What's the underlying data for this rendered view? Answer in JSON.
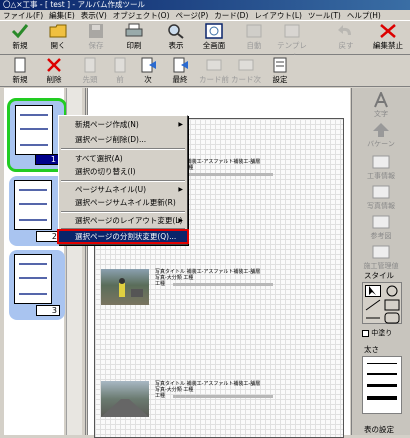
{
  "window": {
    "title": "〇△×工事 - [ test ] - アルバム作成ツール"
  },
  "menubar": [
    "ファイル(F)",
    "編集(E)",
    "表示(V)",
    "オブジェクト(O)",
    "ページ(P)",
    "カード(D)",
    "レイアウト(L)",
    "ツール(T)",
    "ヘルプ(H)"
  ],
  "toolbar1": [
    {
      "label": "新規",
      "icon": "check-icon",
      "enabled": true
    },
    {
      "label": "開く",
      "icon": "folder-icon",
      "enabled": true
    },
    {
      "label": "保存",
      "icon": "save-icon",
      "enabled": false
    },
    {
      "label": "印刷",
      "icon": "printer-icon",
      "enabled": true
    },
    {
      "label": "表示",
      "icon": "magnifier-icon",
      "enabled": true
    },
    {
      "label": "全画面",
      "icon": "fullscreen-icon",
      "enabled": true
    },
    {
      "label": "自動",
      "icon": "auto-icon",
      "enabled": false
    },
    {
      "label": "テンプレート",
      "icon": "template-icon",
      "enabled": false
    },
    {
      "label": "戻す",
      "icon": "undo-icon",
      "enabled": false
    },
    {
      "label": "編集禁止",
      "icon": "edit-lock-icon",
      "enabled": true
    }
  ],
  "toolbar2": [
    {
      "label": "新規",
      "icon": "new-page-icon",
      "enabled": true
    },
    {
      "label": "削除",
      "icon": "delete-icon",
      "enabled": true
    },
    {
      "label": "先頭",
      "icon": "first-page-icon",
      "enabled": false
    },
    {
      "label": "前",
      "icon": "prev-page-icon",
      "enabled": false
    },
    {
      "label": "次",
      "icon": "next-page-icon",
      "enabled": true
    },
    {
      "label": "最終",
      "icon": "last-page-icon",
      "enabled": true
    },
    {
      "label": "カード前",
      "icon": "card-prev-icon",
      "enabled": false
    },
    {
      "label": "カード次",
      "icon": "card-next-icon",
      "enabled": false
    },
    {
      "label": "設定",
      "icon": "settings-icon",
      "enabled": true
    }
  ],
  "thumbnails": [
    {
      "num": "1"
    },
    {
      "num": "2"
    },
    {
      "num": "3"
    }
  ],
  "context_menu": [
    {
      "label": "新規ページ作成(N)",
      "submenu": true
    },
    {
      "label": "選択ページ削除(D)...",
      "submenu": false
    },
    {
      "label": "すべて選択(A)",
      "submenu": false
    },
    {
      "label": "選択の切り替え(I)",
      "submenu": false
    },
    {
      "label": "ページサムネイル(U)",
      "submenu": true
    },
    {
      "label": "選択ページサムネイル更新(R)",
      "submenu": false
    },
    {
      "label": "選択ページのレイアウト変更(L)",
      "submenu": true
    },
    {
      "label": "選択ページの分割状変更(Q)...",
      "submenu": false,
      "selected": true
    }
  ],
  "blocks": [
    {
      "line1": "写真タイトル 補装工-アスファルト補装工-舗層",
      "line2": "写真-大分類 工種",
      "line3": "工種"
    },
    {
      "line1": "写真タイトル 補装工-アスファルト補装工-舗層",
      "line2": "写真-大分類 工種",
      "line3": "工種"
    },
    {
      "line1": "写真タイトル 補装工-アスファルト補装工-舗層",
      "line2": "写真-大分類 工種",
      "line3": "工種"
    }
  ],
  "sidebar": {
    "buttons": [
      {
        "label": "文字",
        "icon": "text-a-icon"
      },
      {
        "label": "バケーン",
        "icon": "arrow-up-icon"
      },
      {
        "label": "工事情報",
        "icon": "construction-info-icon"
      },
      {
        "label": "写真情報",
        "icon": "photo-info-icon"
      },
      {
        "label": "参考図",
        "icon": "reference-figure-icon"
      },
      {
        "label": "施工管理値",
        "icon": "management-value-icon"
      }
    ],
    "style_title": "スタイル",
    "fill_label": "中塗り",
    "thickness_title": "太さ",
    "table_title": "表の設定"
  },
  "colors": {
    "selected_thumb_border": "#22cc22",
    "highlight": "#0a246a",
    "callout": "#e00000"
  }
}
